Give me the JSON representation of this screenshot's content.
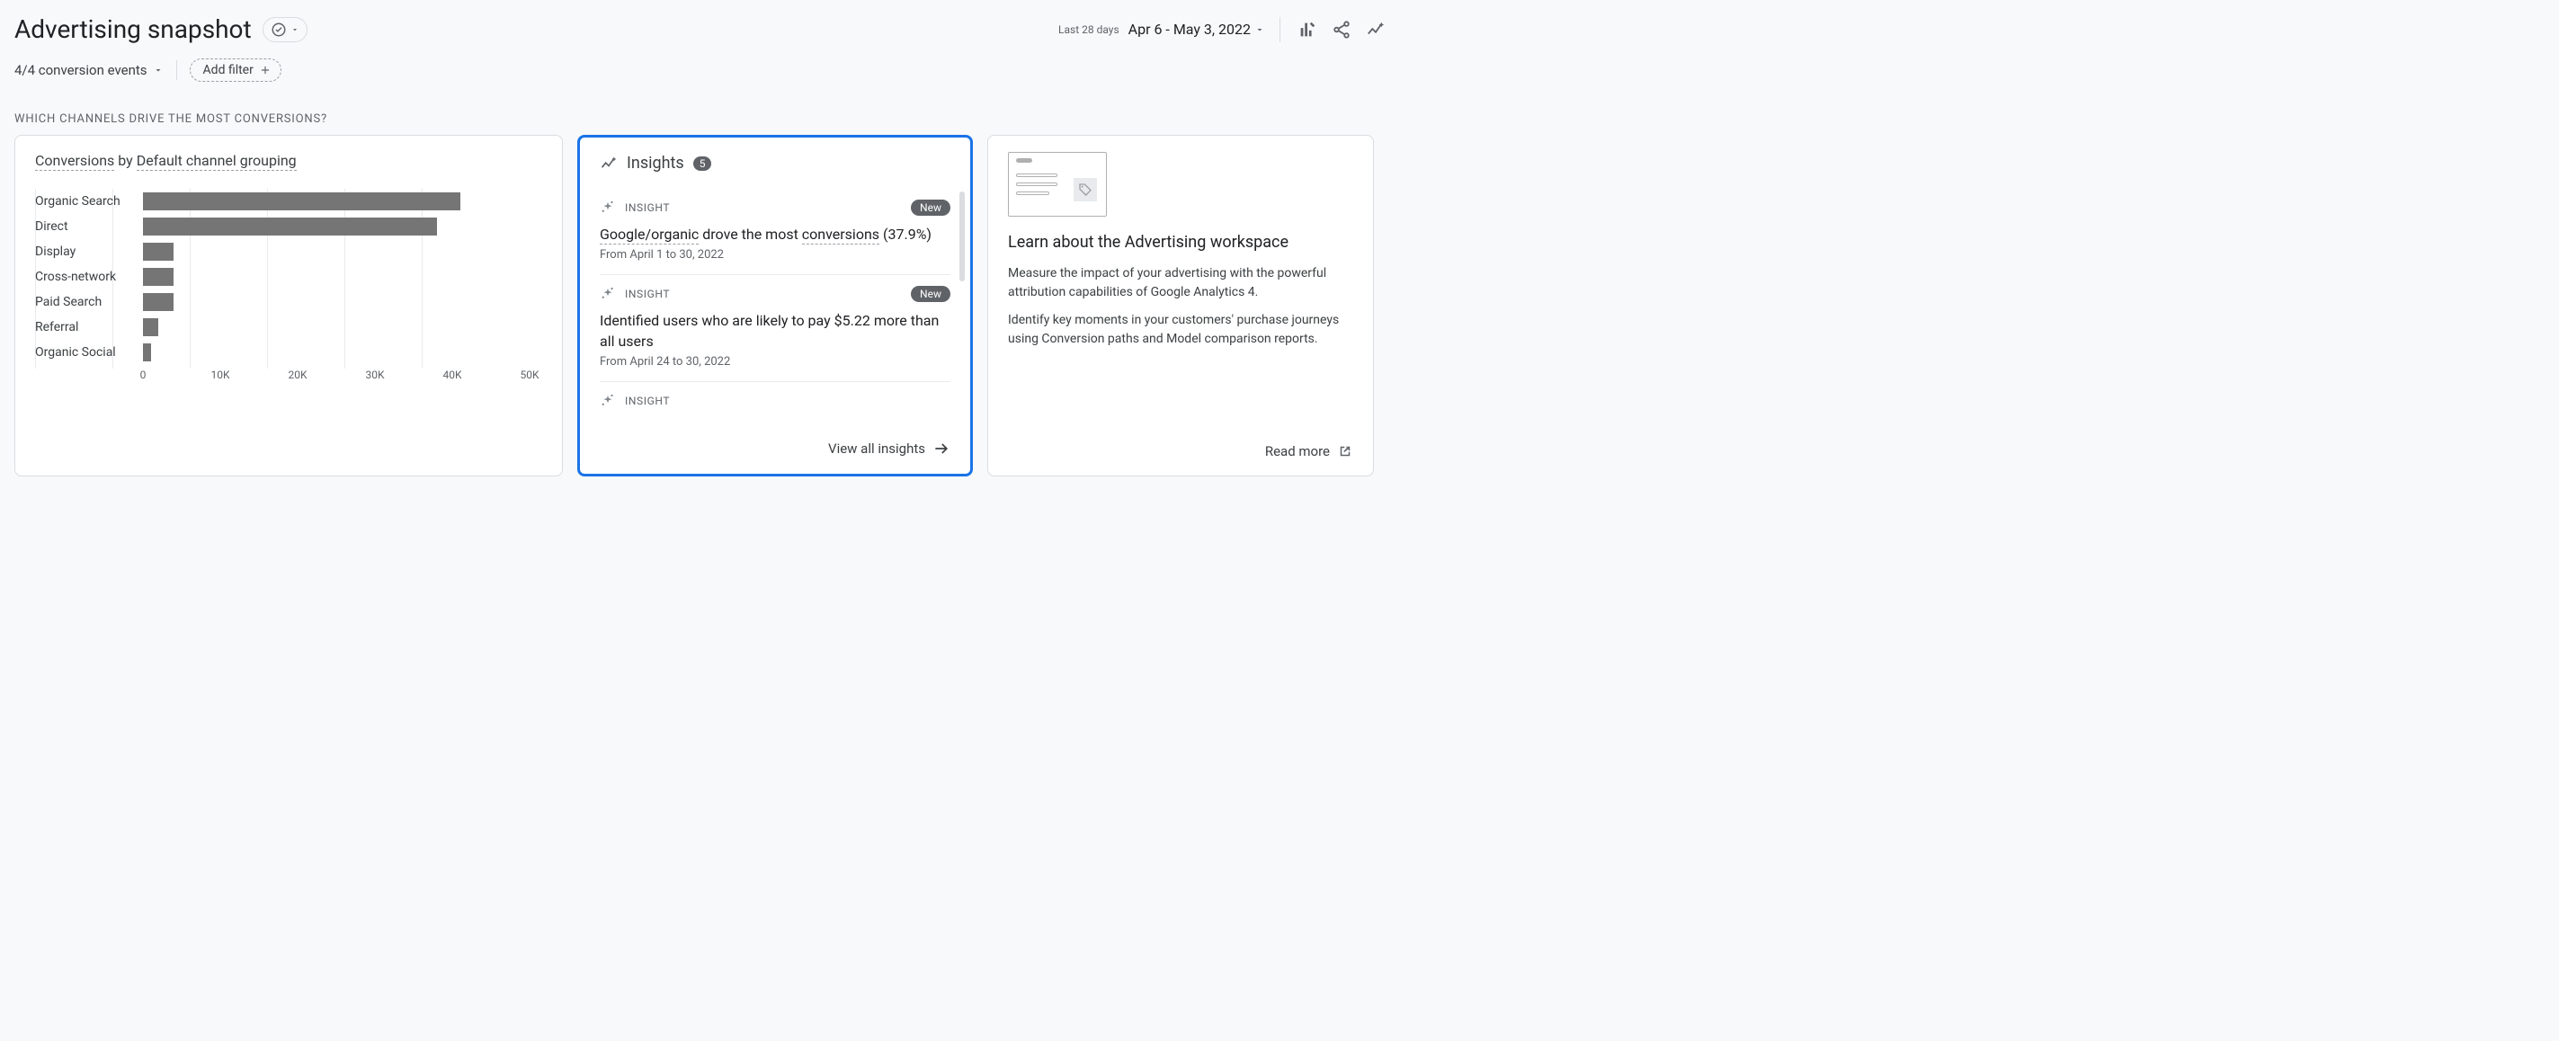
{
  "header": {
    "title": "Advertising snapshot",
    "date_label": "Last 28 days",
    "date_range": "Apr 6 - May 3, 2022"
  },
  "filters": {
    "conversion_events": "4/4 conversion events",
    "add_filter_label": "Add filter"
  },
  "section_label": "WHICH CHANNELS DRIVE THE MOST CONVERSIONS?",
  "chart_card": {
    "title_prefix": "Conversions",
    "title_mid": "by",
    "title_suffix": "Default channel grouping"
  },
  "chart_data": {
    "type": "bar",
    "orientation": "horizontal",
    "categories": [
      "Organic Search",
      "Direct",
      "Display",
      "Cross-network",
      "Paid Search",
      "Referral",
      "Organic Social"
    ],
    "values": [
      41000,
      38000,
      4000,
      4000,
      4000,
      2000,
      1000
    ],
    "xticks": [
      0,
      10000,
      20000,
      30000,
      40000,
      50000
    ],
    "xtick_labels": [
      "0",
      "10K",
      "20K",
      "30K",
      "40K",
      "50K"
    ],
    "xlim": [
      0,
      50000
    ],
    "xlabel": "",
    "ylabel": "",
    "title": "Conversions by Default channel grouping",
    "bar_color": "#757575"
  },
  "insights_card": {
    "title": "Insights",
    "count": "5",
    "insight_label": "INSIGHT",
    "new_label": "New",
    "view_all": "View all insights",
    "items": [
      {
        "is_new": true,
        "title_dotted_1": "Google/organic",
        "title_mid": " drove the most ",
        "title_dotted_2": "conversions",
        "title_tail": " (37.9%)",
        "date": "From April 1 to 30, 2022"
      },
      {
        "is_new": true,
        "title_plain": "Identified users who are likely to pay $5.22 more than all users",
        "date": "From April 24 to 30, 2022"
      }
    ]
  },
  "learn_card": {
    "title": "Learn about the Advertising workspace",
    "body1": "Measure the impact of your advertising with the powerful attribution capabilities of Google Analytics 4.",
    "body2": "Identify key moments in your customers' purchase journeys using Conversion paths and Model comparison reports.",
    "read_more": "Read more"
  }
}
